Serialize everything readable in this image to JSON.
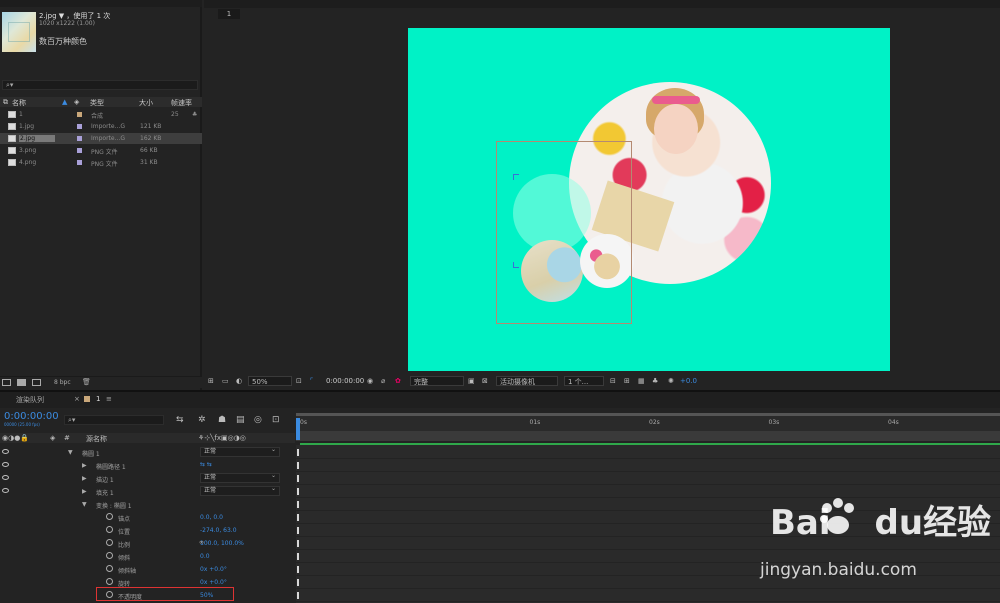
{
  "project": {
    "item_name": "2.jpg ▼",
    "item_usage": "，使用了 1 次",
    "item_dims": "1020 x1222 (1.00)",
    "item_color": "数百万种颜色",
    "columns": {
      "name": "名称",
      "type": "类型",
      "size": "大小",
      "fps": "帧速率"
    },
    "items": [
      {
        "name": "1",
        "type": "合成",
        "size": "",
        "fps": "25",
        "label_color": "#c9a77a",
        "icon": "comp-icon"
      },
      {
        "name": "1.jpg",
        "type": "Importe...G",
        "size": "121 KB",
        "fps": "",
        "label_color": "#a9a0d8",
        "icon": "jpg-file-icon"
      },
      {
        "name": "2.jpg",
        "type": "Importe...G",
        "size": "162 KB",
        "fps": "",
        "label_color": "#a9a0d8",
        "icon": "jpg-file-icon",
        "selected": true
      },
      {
        "name": "3.png",
        "type": "PNG 文件",
        "size": "66 KB",
        "fps": "",
        "label_color": "#a9a0d8",
        "icon": "png-file-icon"
      },
      {
        "name": "4.png",
        "type": "PNG 文件",
        "size": "31 KB",
        "fps": "",
        "label_color": "#a9a0d8",
        "icon": "png-file-icon"
      }
    ],
    "bpc": "8 bpc"
  },
  "viewer": {
    "tab": "1",
    "zoom": "50%",
    "timecode": "0:00:00:00",
    "resolution": "完整",
    "camera": "活动摄像机",
    "views": "1 个...",
    "exposure": "+0.0",
    "comp_bg": "#00f2c6"
  },
  "timeline": {
    "render_queue_tab": "渲染队列",
    "comp_tab": "1",
    "timecode": "0:00:00:00",
    "fps": "00000 (25.00 fps)",
    "col_name": "源名称",
    "ruler": [
      "0s",
      "01s",
      "02s",
      "03s",
      "04s",
      "05s"
    ],
    "rows": [
      {
        "name": "椭圆 1",
        "indent": 0,
        "arrow": "▼",
        "mode": "正常",
        "eye": true
      },
      {
        "name": "椭圆路径 1",
        "indent": 1,
        "arrow": "▶",
        "eye": true
      },
      {
        "name": "描边 1",
        "indent": 1,
        "arrow": "▶",
        "mode": "正常",
        "eye": true
      },
      {
        "name": "填充 1",
        "indent": 1,
        "arrow": "▶",
        "mode": "正常",
        "eye": true
      },
      {
        "name": "变换 : 椭圆 1",
        "indent": 1,
        "arrow": "▼"
      },
      {
        "name": "锚点",
        "indent": 2,
        "value": "0.0, 0.0"
      },
      {
        "name": "位置",
        "indent": 2,
        "value": "-274.0, 63.0"
      },
      {
        "name": "比例",
        "indent": 2,
        "value": "100.0, 100.0%"
      },
      {
        "name": "倾斜",
        "indent": 2,
        "value": "0.0"
      },
      {
        "name": "倾斜轴",
        "indent": 2,
        "value": "0x +0.0°"
      },
      {
        "name": "旋转",
        "indent": 2,
        "value": "0x +0.0°"
      },
      {
        "name": "不透明度",
        "indent": 2,
        "value": "50%",
        "highlight": true
      }
    ]
  },
  "watermark": {
    "brand_a": "Bai",
    "brand_b": "du",
    "brand_c": "经验",
    "url": "jingyan.baidu.com"
  }
}
